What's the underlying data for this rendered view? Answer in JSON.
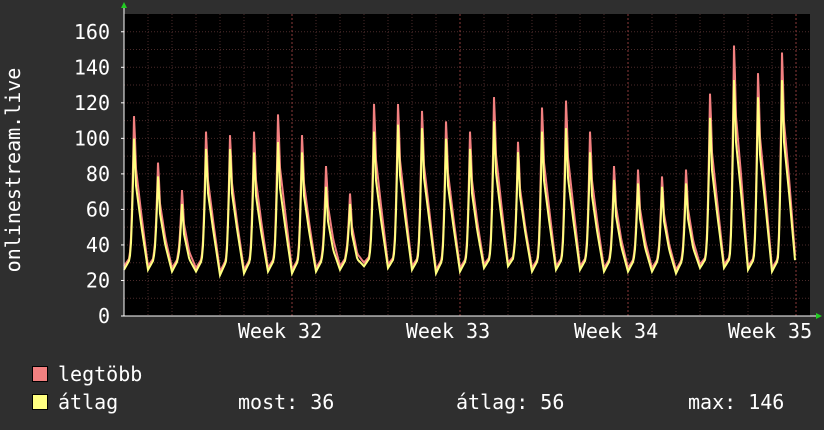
{
  "chart_data": {
    "type": "line",
    "ylabel": "onlinestream.live",
    "ylim": [
      0,
      170
    ],
    "yticks": [
      0,
      20,
      40,
      60,
      80,
      100,
      120,
      140,
      160
    ],
    "xlim": [
      0,
      28
    ],
    "x_tick_labels": [
      {
        "label": "Week 32",
        "x": 7
      },
      {
        "label": "Week 33",
        "x": 14
      },
      {
        "label": "Week 34",
        "x": 21
      },
      {
        "label": "Week 35",
        "x": 28
      }
    ],
    "grid": true,
    "daily_peaks": {
      "max_series": [
        115,
        88,
        72,
        106,
        104,
        106,
        116,
        104,
        86,
        70,
        122,
        122,
        118,
        112,
        106,
        126,
        100,
        120,
        124,
        106,
        86,
        84,
        80,
        84,
        128,
        156,
        140,
        152
      ],
      "avg_series": [
        102,
        80,
        64,
        96,
        96,
        94,
        100,
        94,
        74,
        64,
        106,
        110,
        108,
        102,
        96,
        112,
        94,
        106,
        108,
        94,
        78,
        76,
        74,
        76,
        114,
        136,
        126,
        136
      ]
    },
    "daily_troughs": [
      26,
      26,
      25,
      25,
      23,
      24,
      25,
      24,
      25,
      26,
      28,
      27,
      26,
      24,
      25,
      27,
      28,
      25,
      26,
      26,
      25,
      25,
      25,
      24,
      27,
      27,
      26,
      25
    ],
    "series": [
      {
        "name": "legtöbb",
        "color": "#f28080"
      },
      {
        "name": "átlag",
        "color": "#ffff80"
      }
    ]
  },
  "legend": {
    "max_label": "legtöbb",
    "avg_label": "átlag",
    "now_label": "most: 36",
    "mean_label": "átlag: 56",
    "peak_label": "max: 146"
  },
  "colors": {
    "background": "#2f2f2f",
    "plot_bg": "#000000",
    "grid_minor": "#4a2a2a",
    "grid_major": "#8a3a3a",
    "axis": "#ffffff",
    "arrow": "#22cc22"
  }
}
